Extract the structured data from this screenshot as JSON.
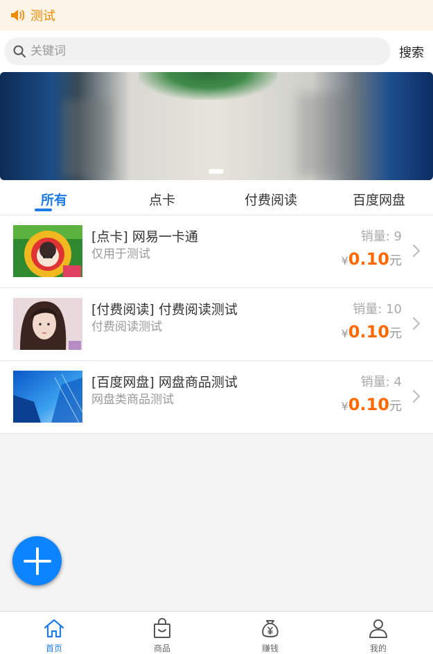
{
  "notice": {
    "text": "测试",
    "icon": "speaker-icon",
    "color": "#f08a00"
  },
  "search": {
    "placeholder": "关键词",
    "value": "",
    "button_label": "搜索"
  },
  "tabs": [
    {
      "label": "所有",
      "active": true
    },
    {
      "label": "点卡",
      "active": false
    },
    {
      "label": "付费阅读",
      "active": false
    },
    {
      "label": "百度网盘",
      "active": false
    }
  ],
  "products": [
    {
      "title": "[点卡] 网易一卡通",
      "desc": "仅用于测试",
      "sales": "销量: 9",
      "currency": "¥",
      "price": "0.10",
      "unit": "元"
    },
    {
      "title": "[付费阅读] 付费阅读测试",
      "desc": "付费阅读测试",
      "sales": "销量: 10",
      "currency": "¥",
      "price": "0.10",
      "unit": "元"
    },
    {
      "title": "[百度网盘] 网盘商品测试",
      "desc": "网盘类商品测试",
      "sales": "销量: 4",
      "currency": "¥",
      "price": "0.10",
      "unit": "元"
    }
  ],
  "nav": [
    {
      "label": "首页",
      "icon": "home-icon",
      "active": true
    },
    {
      "label": "商品",
      "icon": "shopping-bag-icon",
      "active": false
    },
    {
      "label": "赚钱",
      "icon": "money-bag-icon",
      "active": false
    },
    {
      "label": "我的",
      "icon": "user-icon",
      "active": false
    }
  ],
  "colors": {
    "accent": "#1e7be6",
    "price": "#ff6a00",
    "fab": "#0d84ff"
  }
}
